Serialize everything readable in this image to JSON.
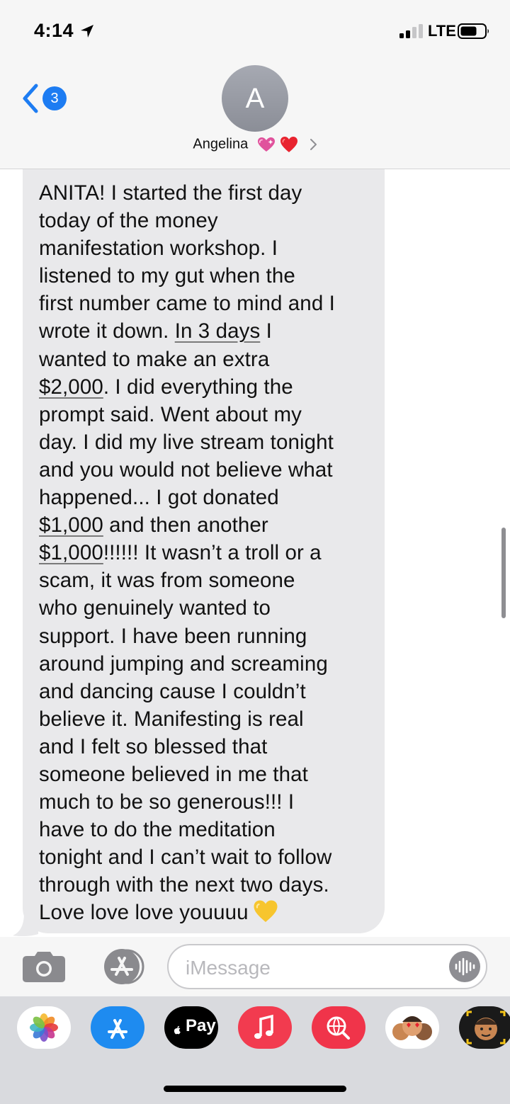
{
  "status_bar": {
    "time": "4:14",
    "carrier": "LTE",
    "icons": [
      "location-arrow-icon",
      "cellular-signal-icon",
      "battery-icon"
    ]
  },
  "header": {
    "back_badge_count": "3",
    "avatar_initial": "A",
    "contact_name": "Angelina",
    "icons": [
      "chevron-left-icon",
      "sparkling-heart-emoji",
      "red-heart-emoji",
      "chevron-right-icon"
    ]
  },
  "message": {
    "sender": "received",
    "lines": [
      {
        "segments": [
          {
            "text": "ANITA! I started the first day"
          }
        ]
      },
      {
        "segments": [
          {
            "text": "today of the money"
          }
        ]
      },
      {
        "segments": [
          {
            "text": "manifestation workshop. I"
          }
        ]
      },
      {
        "segments": [
          {
            "text": "listened to my gut when the"
          }
        ]
      },
      {
        "segments": [
          {
            "text": "first number came to mind and I"
          }
        ]
      },
      {
        "segments": [
          {
            "text": "wrote it down. "
          },
          {
            "text": "In 3 days",
            "underline": true
          },
          {
            "text": " I"
          }
        ]
      },
      {
        "segments": [
          {
            "text": "wanted to make an extra"
          }
        ]
      },
      {
        "segments": [
          {
            "text": "$2,000",
            "underline": true
          },
          {
            "text": ". I did everything the"
          }
        ]
      },
      {
        "segments": [
          {
            "text": "prompt said. Went about my"
          }
        ]
      },
      {
        "segments": [
          {
            "text": "day. I did my live stream tonight"
          }
        ]
      },
      {
        "segments": [
          {
            "text": "and you would not believe what"
          }
        ]
      },
      {
        "segments": [
          {
            "text": "happened... I got donated"
          }
        ]
      },
      {
        "segments": [
          {
            "text": "$1,000",
            "underline": true
          },
          {
            "text": " and then another"
          }
        ]
      },
      {
        "segments": [
          {
            "text": "$1,000",
            "underline": true
          },
          {
            "text": "!!!!!! It wasn’t a troll or a"
          }
        ]
      },
      {
        "segments": [
          {
            "text": "scam, it was from someone"
          }
        ]
      },
      {
        "segments": [
          {
            "text": "who genuinely wanted to"
          }
        ]
      },
      {
        "segments": [
          {
            "text": "support. I have been running"
          }
        ]
      },
      {
        "segments": [
          {
            "text": "around jumping and screaming"
          }
        ]
      },
      {
        "segments": [
          {
            "text": "and dancing cause I couldn’t"
          }
        ]
      },
      {
        "segments": [
          {
            "text": "believe it. Manifesting is real"
          }
        ]
      },
      {
        "segments": [
          {
            "text": "and I felt so blessed that"
          }
        ]
      },
      {
        "segments": [
          {
            "text": "someone believed in me that"
          }
        ]
      },
      {
        "segments": [
          {
            "text": "much to be so generous!!! I"
          }
        ]
      },
      {
        "segments": [
          {
            "text": "have to do the meditation"
          }
        ]
      },
      {
        "segments": [
          {
            "text": "tonight and I can’t wait to follow"
          }
        ]
      },
      {
        "segments": [
          {
            "text": "through with the next two days."
          }
        ]
      },
      {
        "segments": [
          {
            "text": "Love love love youuuu"
          }
        ],
        "trailing_emoji": "yellow-heart-emoji"
      }
    ]
  },
  "input_bar": {
    "placeholder": "iMessage",
    "icons": [
      "camera-icon",
      "app-store-icon",
      "audio-waveform-icon"
    ]
  },
  "app_drawer": {
    "apps": [
      {
        "name": "photos",
        "icon": "photos-flower-icon",
        "bg": "#ffffff"
      },
      {
        "name": "app-store",
        "icon": "app-store-icon",
        "bg": "#1e8bf0"
      },
      {
        "name": "apple-pay",
        "icon": "apple-pay-icon",
        "label": "Pay",
        "bg": "#000000"
      },
      {
        "name": "music",
        "icon": "music-note-icon",
        "bg": "#f23b4f"
      },
      {
        "name": "images-search",
        "icon": "globe-search-icon",
        "bg": "#f0344a"
      },
      {
        "name": "animoji-stickers",
        "icon": "memoji-stickers-icon",
        "bg": "#ffffff"
      },
      {
        "name": "memoji",
        "icon": "memoji-face-icon",
        "bg": "#1a1a1a"
      }
    ]
  },
  "colors": {
    "ios_blue": "#1d7cf2",
    "received_bubble": "#e9e9eb",
    "bar_background": "#f6f6f6",
    "drawer_background": "#d9dade"
  }
}
